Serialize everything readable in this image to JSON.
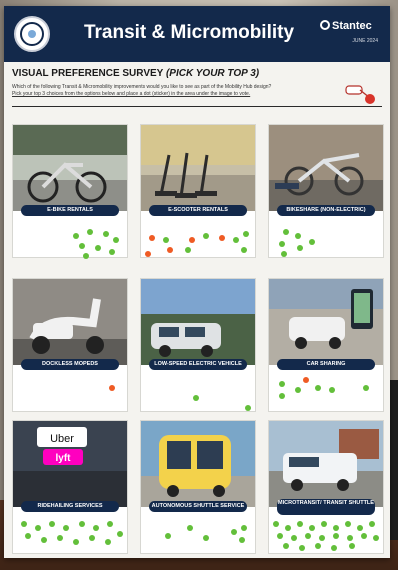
{
  "poster": {
    "title": "Transit & Micromobility",
    "brand": "Stantec",
    "date": "JUNE 2024",
    "survey_title": "VISUAL PREFERENCE SURVEY",
    "survey_subtitle": "(PICK YOUR TOP 3)",
    "instruction_1": "Which of the following Transit & Micromobility improvements would you like to see as part of the Mobility Hub design?",
    "instruction_2": "Pick your top 3 choices from the options below and place a dot (sticker) in the area under the image to vote.",
    "seal_text": "CITY OF MOBILITY HUB"
  },
  "colors": {
    "header": "#13294b",
    "sticker_green": "#63bf3a",
    "sticker_orange": "#ef5b24"
  },
  "options": [
    {
      "label": "E-BIKE RENTALS",
      "green_dots": 8,
      "orange_dots": 0
    },
    {
      "label": "E-SCOOTER RENTALS",
      "green_dots": 6,
      "orange_dots": 5
    },
    {
      "label": "BIKESHARE (NON-ELECTRIC)",
      "green_dots": 6,
      "orange_dots": 0
    },
    {
      "label": "DOCKLESS MOPEDS",
      "green_dots": 0,
      "orange_dots": 1
    },
    {
      "label": "LOW-SPEED ELECTRIC VEHICLE",
      "green_dots": 2,
      "orange_dots": 0
    },
    {
      "label": "CAR SHARING",
      "green_dots": 6,
      "orange_dots": 1
    },
    {
      "label": "RIDEHAILING SERVICES",
      "green_dots": 14,
      "orange_dots": 0
    },
    {
      "label": "AUTONOMOUS SHUTTLE SERVICE",
      "green_dots": 6,
      "orange_dots": 0
    },
    {
      "label": "MICROTRANSIT/ TRANSIT SHUTTLE",
      "green_dots": 22,
      "orange_dots": 0
    }
  ],
  "photo_text": {
    "uber": "Uber",
    "lyft": "lyft"
  }
}
